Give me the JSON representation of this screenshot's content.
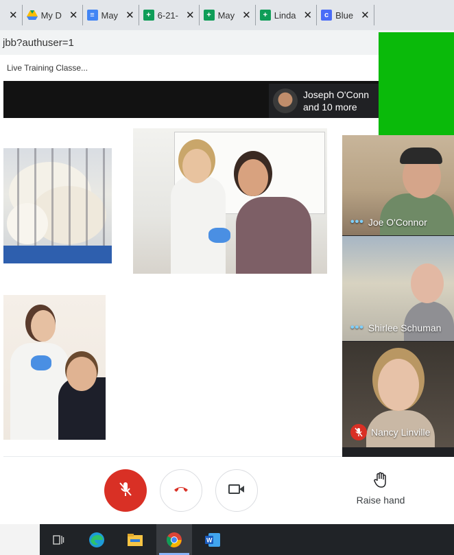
{
  "browser": {
    "tabs": [
      {
        "label": "",
        "icon": "generic-tab-icon"
      },
      {
        "label": "My D",
        "icon": "google-drive-icon"
      },
      {
        "label": "May",
        "icon": "google-docs-icon"
      },
      {
        "label": "6-21-",
        "icon": "google-sheets-icon"
      },
      {
        "label": "May",
        "icon": "google-sheets-icon"
      },
      {
        "label": "Linda",
        "icon": "google-sheets-icon"
      },
      {
        "label": "Blue",
        "icon": "blue-circle-icon"
      }
    ],
    "address": "jbb?authuser=1",
    "bookmark": "Live Training Classe..."
  },
  "meeting": {
    "participants_pill": {
      "line1": "Joseph O'Conn",
      "line2": "and 10 more"
    },
    "tiles": [
      {
        "name": "Joe O'Connor",
        "status": "speaking-dots-icon"
      },
      {
        "name": "Shirlee Schuman",
        "status": "speaking-dots-icon"
      },
      {
        "name": "Nancy Linville",
        "status": "mic-off-icon"
      }
    ],
    "controls": {
      "raise_hand_label": "Raise hand"
    }
  },
  "colors": {
    "mic_off_red": "#d93025",
    "green_overlay": "#0aba0a",
    "meet_dark": "#202124"
  }
}
